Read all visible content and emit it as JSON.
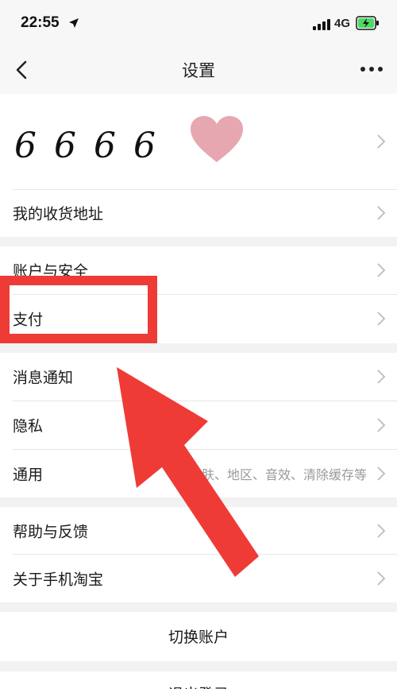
{
  "status_bar": {
    "time": "22:55",
    "network": "4G"
  },
  "nav": {
    "title": "设置"
  },
  "profile": {
    "name": "6666"
  },
  "items": {
    "address": "我的收货地址",
    "account_security": "账户与安全",
    "payment": "支付",
    "notifications": "消息通知",
    "privacy": "隐私",
    "general": "通用",
    "general_hint": "皮肤、地区、音效、清除缓存等",
    "help": "帮助与反馈",
    "about": "关于手机淘宝"
  },
  "actions": {
    "switch_account": "切换账户",
    "logout": "退出登录"
  },
  "colors": {
    "highlight_red": "#ef3b36",
    "heart_pink": "#e7a7b0",
    "hint_gray": "#999999"
  },
  "icons": [
    "location-arrow-icon",
    "signal-icon",
    "battery-charging-icon",
    "back-chevron-icon",
    "more-icon",
    "heart-icon",
    "chevron-right-icon"
  ]
}
